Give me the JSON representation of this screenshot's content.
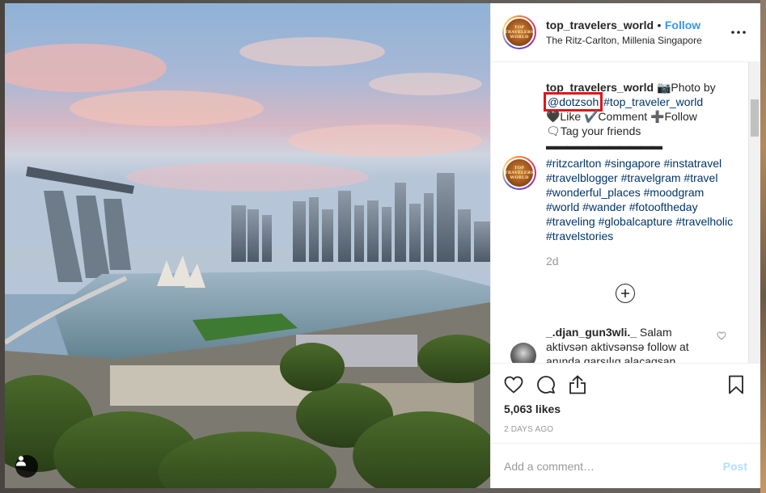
{
  "post": {
    "username": "top_travelers_world",
    "separator": "•",
    "follow_label": "Follow",
    "location": "The Ritz-Carlton, Millenia Singapore",
    "avatar_text": "TOP TRAVELERS WORLD"
  },
  "caption": {
    "username": "top_travelers_world",
    "photo_by": "📷Photo by",
    "mention": "@dotzsoh",
    "tag_after_mention": "#top_traveler_world",
    "line_actions": "🖤Like ✔️Comment ➕Follow",
    "line_tag": "🗨Tag your friends",
    "divider": "▬▬▬▬▬▬▬▬▬▬▬",
    "hashtags": "#ritzcarlton #singapore #instatravel #travelblogger #travelgram #travel #wonderful_places #moodgram #world #wander #fotooftheday #traveling #globalcapture #travelholic #travelstories",
    "time_ago": "2d"
  },
  "comments": [
    {
      "username": "_.djan_gun3wli._",
      "text": "Salam aktivsən aktivsənsə follow at anında qarşılıq alacaqsan"
    }
  ],
  "actions": {
    "likes": "5,063 likes",
    "date": "2 DAYS AGO"
  },
  "comment_box": {
    "placeholder": "Add a comment…",
    "post_label": "Post"
  },
  "icons": [
    "user-tag-icon",
    "more-options-icon",
    "load-more-plus-icon",
    "heart-icon",
    "comment-icon",
    "share-icon",
    "bookmark-icon"
  ],
  "colors": {
    "link_blue": "#3897f0",
    "hashtag_blue": "#003569",
    "highlight_red": "#e0151a",
    "post_disabled": "#b2dffc"
  }
}
